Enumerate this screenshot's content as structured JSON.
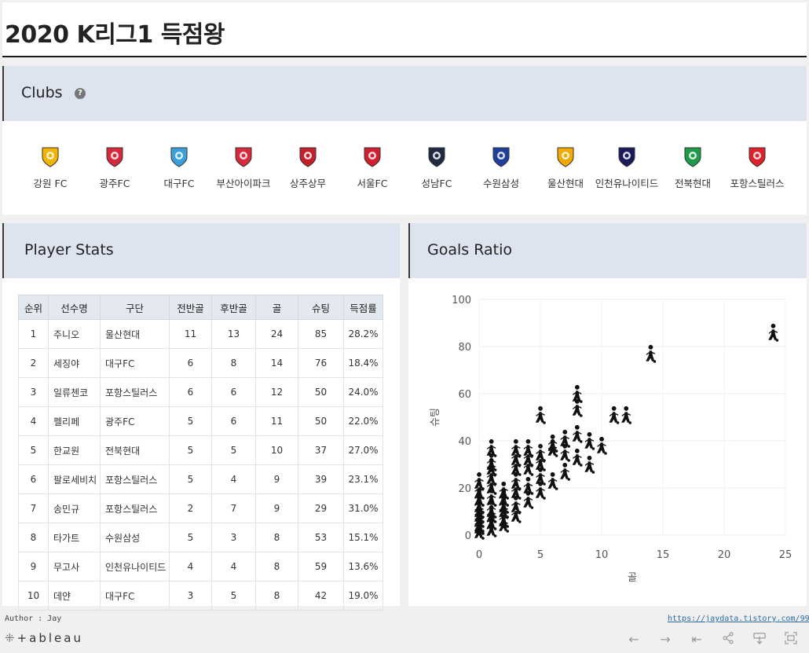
{
  "page": {
    "title": "2020 K리그1 득점왕"
  },
  "clubs": {
    "title": "Clubs",
    "help_icon": "?",
    "items": [
      {
        "name": "강원 FC",
        "icon": "gangwon-logo-icon",
        "color": "#f2b400"
      },
      {
        "name": "광주FC",
        "icon": "gwangju-logo-icon",
        "color": "#d8283c"
      },
      {
        "name": "대구FC",
        "icon": "daegu-logo-icon",
        "color": "#3aa0dc"
      },
      {
        "name": "부산아이파크",
        "icon": "busan-logo-icon",
        "color": "#d8283c"
      },
      {
        "name": "상주상무",
        "icon": "sangju-logo-icon",
        "color": "#c4202a"
      },
      {
        "name": "서울FC",
        "icon": "seoul-logo-icon",
        "color": "#d02030"
      },
      {
        "name": "성남FC",
        "icon": "seongnam-logo-icon",
        "color": "#1f2a44"
      },
      {
        "name": "수원삼성",
        "icon": "suwon-logo-icon",
        "color": "#1e3f9a"
      },
      {
        "name": "울산현대",
        "icon": "ulsan-logo-icon",
        "color": "#f2a900"
      },
      {
        "name": "인천유나이티드",
        "icon": "incheon-logo-icon",
        "color": "#1a1a5c"
      },
      {
        "name": "전북현대",
        "icon": "jeonbuk-logo-icon",
        "color": "#1f9a48"
      },
      {
        "name": "포항스틸러스",
        "icon": "pohang-logo-icon",
        "color": "#e0202a"
      }
    ]
  },
  "stats": {
    "title": "Player Stats",
    "headers": [
      "순위",
      "선수명",
      "구단",
      "전반골",
      "후반골",
      "골",
      "슈팅",
      "득점률"
    ],
    "rows": [
      [
        "1",
        "주니오",
        "울산현대",
        "11",
        "13",
        "24",
        "85",
        "28.2%"
      ],
      [
        "2",
        "세징야",
        "대구FC",
        "6",
        "8",
        "14",
        "76",
        "18.4%"
      ],
      [
        "3",
        "일류첸코",
        "포항스틸러스",
        "6",
        "6",
        "12",
        "50",
        "24.0%"
      ],
      [
        "4",
        "펠리페",
        "광주FC",
        "5",
        "6",
        "11",
        "50",
        "22.0%"
      ],
      [
        "5",
        "한교원",
        "전북현대",
        "5",
        "5",
        "10",
        "37",
        "27.0%"
      ],
      [
        "6",
        "팔로세비치",
        "포항스틸러스",
        "5",
        "4",
        "9",
        "39",
        "23.1%"
      ],
      [
        "7",
        "송민규",
        "포항스틸러스",
        "2",
        "7",
        "9",
        "29",
        "31.0%"
      ],
      [
        "8",
        "타가트",
        "수원삼성",
        "5",
        "3",
        "8",
        "53",
        "15.1%"
      ],
      [
        "9",
        "무고사",
        "인천유나이티드",
        "4",
        "4",
        "8",
        "59",
        "13.6%"
      ],
      [
        "10",
        "데얀",
        "대구FC",
        "3",
        "5",
        "8",
        "42",
        "19.0%"
      ]
    ]
  },
  "goals": {
    "title": "Goals Ratio"
  },
  "chart_data": {
    "type": "scatter",
    "xlabel": "골",
    "ylabel": "슈팅",
    "xlim": [
      0,
      25
    ],
    "ylim": [
      0,
      100
    ],
    "xticks": [
      "0",
      "5",
      "10",
      "15",
      "20",
      "25"
    ],
    "yticks": [
      "0",
      "20",
      "40",
      "60",
      "80",
      "100"
    ],
    "marker": "soccer-player-icon",
    "grid": true,
    "points": [
      [
        24,
        85
      ],
      [
        14,
        76
      ],
      [
        12,
        50
      ],
      [
        11,
        50
      ],
      [
        10,
        37
      ],
      [
        9,
        39
      ],
      [
        9,
        29
      ],
      [
        8,
        53
      ],
      [
        8,
        59
      ],
      [
        8,
        42
      ],
      [
        8,
        32
      ],
      [
        7,
        34
      ],
      [
        7,
        26
      ],
      [
        7,
        40
      ],
      [
        6,
        36
      ],
      [
        6,
        22
      ],
      [
        6,
        38
      ],
      [
        5,
        50
      ],
      [
        5,
        34
      ],
      [
        5,
        24
      ],
      [
        5,
        18
      ],
      [
        5,
        30
      ],
      [
        4,
        32
      ],
      [
        4,
        20
      ],
      [
        4,
        28
      ],
      [
        4,
        14
      ],
      [
        4,
        36
      ],
      [
        3,
        36
      ],
      [
        3,
        22
      ],
      [
        3,
        12
      ],
      [
        3,
        28
      ],
      [
        3,
        8
      ],
      [
        3,
        32
      ],
      [
        3,
        18
      ],
      [
        2,
        12
      ],
      [
        2,
        6
      ],
      [
        2,
        18
      ],
      [
        2,
        4
      ],
      [
        2,
        10
      ],
      [
        2,
        15
      ],
      [
        1,
        36
      ],
      [
        1,
        28
      ],
      [
        1,
        20
      ],
      [
        1,
        10
      ],
      [
        1,
        5
      ],
      [
        1,
        2
      ],
      [
        1,
        15
      ],
      [
        1,
        24
      ],
      [
        1,
        8
      ],
      [
        1,
        30
      ],
      [
        0,
        22
      ],
      [
        0,
        15
      ],
      [
        0,
        10
      ],
      [
        0,
        6
      ],
      [
        0,
        3
      ],
      [
        0,
        1
      ],
      [
        0,
        18
      ],
      [
        0,
        12
      ],
      [
        0,
        8
      ],
      [
        0,
        4
      ]
    ]
  },
  "footer": {
    "author": "Author : Jay",
    "link": "https://jaydata.tistory.com/99",
    "brand": "+ableau",
    "toolbar": [
      "←",
      "→",
      "⇤",
      "share",
      "download",
      "fullscreen"
    ]
  }
}
